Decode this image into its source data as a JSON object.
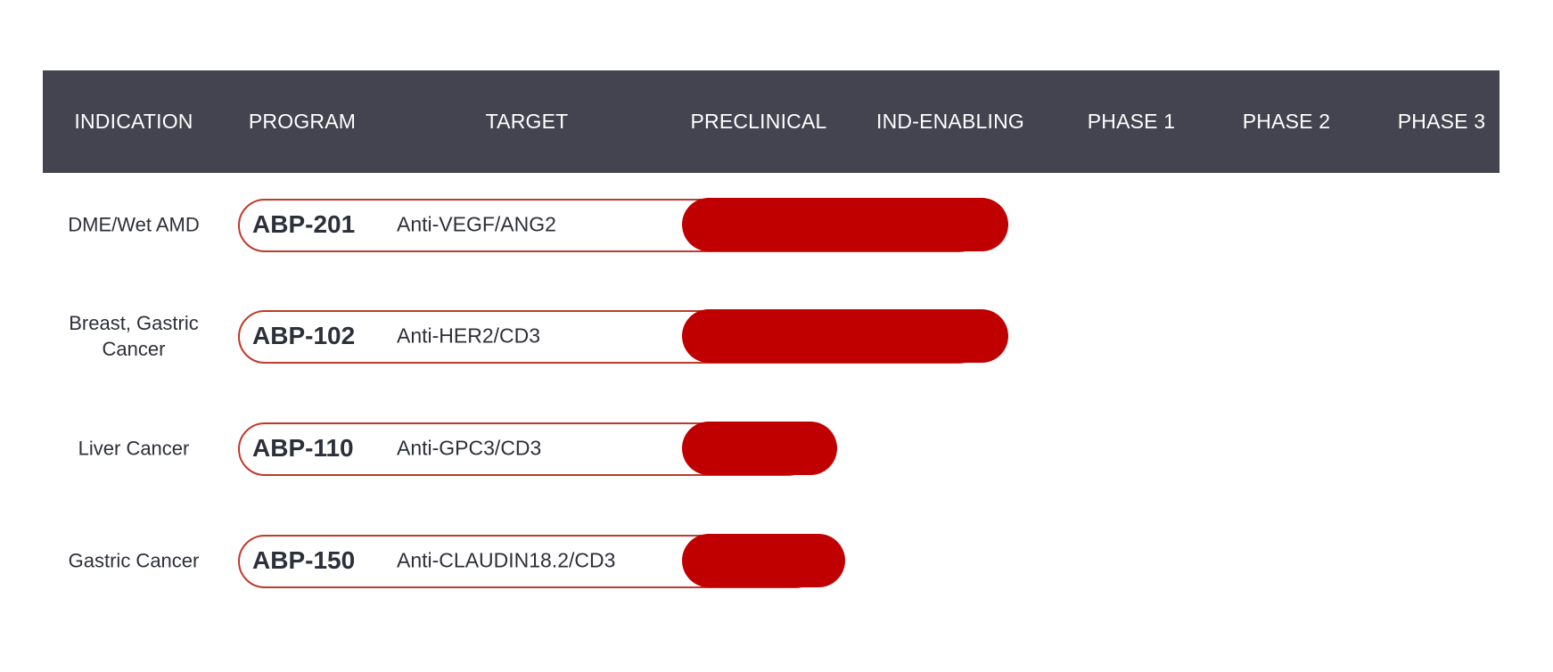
{
  "chart_data": {
    "type": "bar",
    "title": "",
    "orientation": "horizontal",
    "columns": [
      "INDICATION",
      "PROGRAM",
      "TARGET",
      "PRECLINICAL",
      "IND-ENABLING",
      "PHASE 1",
      "PHASE 2",
      "PHASE 3"
    ],
    "stages": [
      "PRECLINICAL",
      "IND-ENABLING",
      "PHASE 1",
      "PHASE 2",
      "PHASE 3"
    ],
    "rows": [
      {
        "indication": "DME/Wet AMD",
        "program": "ABP-201",
        "target": "Anti-VEGF/ANG2",
        "progress_stages": 2.0
      },
      {
        "indication": "Breast, Gastric Cancer",
        "program": "ABP-102",
        "target": "Anti-HER2/CD3",
        "progress_stages": 2.0
      },
      {
        "indication": "Liver Cancer",
        "program": "ABP-110",
        "target": "Anti-GPC3/CD3",
        "progress_stages": 0.95
      },
      {
        "indication": "Gastric Cancer",
        "program": "ABP-150",
        "target": "Anti-CLAUDIN18.2/CD3",
        "progress_stages": 1.0
      }
    ],
    "colors": {
      "header_bg": "#43444f",
      "bar_fill": "#c00000",
      "bar_outline": "#c0392b",
      "text": "#2d2f3a"
    }
  }
}
